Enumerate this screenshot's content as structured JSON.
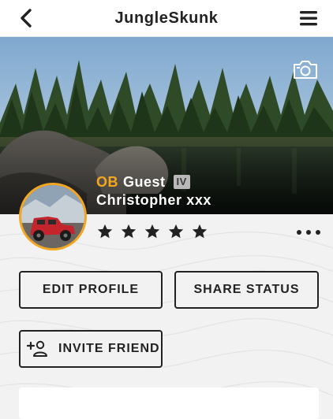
{
  "header": {
    "title": "JungleSkunk",
    "back_icon": "chevron-left-icon",
    "menu_icon": "hamburger-menu-icon"
  },
  "cover": {
    "camera_icon": "camera-icon"
  },
  "profile": {
    "rank_prefix": "OB",
    "rank_name": "Guest",
    "level_badge": "IV",
    "user_name": "Christopher xxx",
    "rating_stars": 5,
    "more_icon": "more-horizontal-icon"
  },
  "actions": {
    "edit_profile": "EDIT PROFILE",
    "share_status": "SHARE STATUS",
    "invite_friend": "INVITE FRIEND",
    "invite_icon": "add-person-icon"
  },
  "colors": {
    "accent": "#f4a71e",
    "text": "#222222",
    "background": "#f2f2f2"
  }
}
